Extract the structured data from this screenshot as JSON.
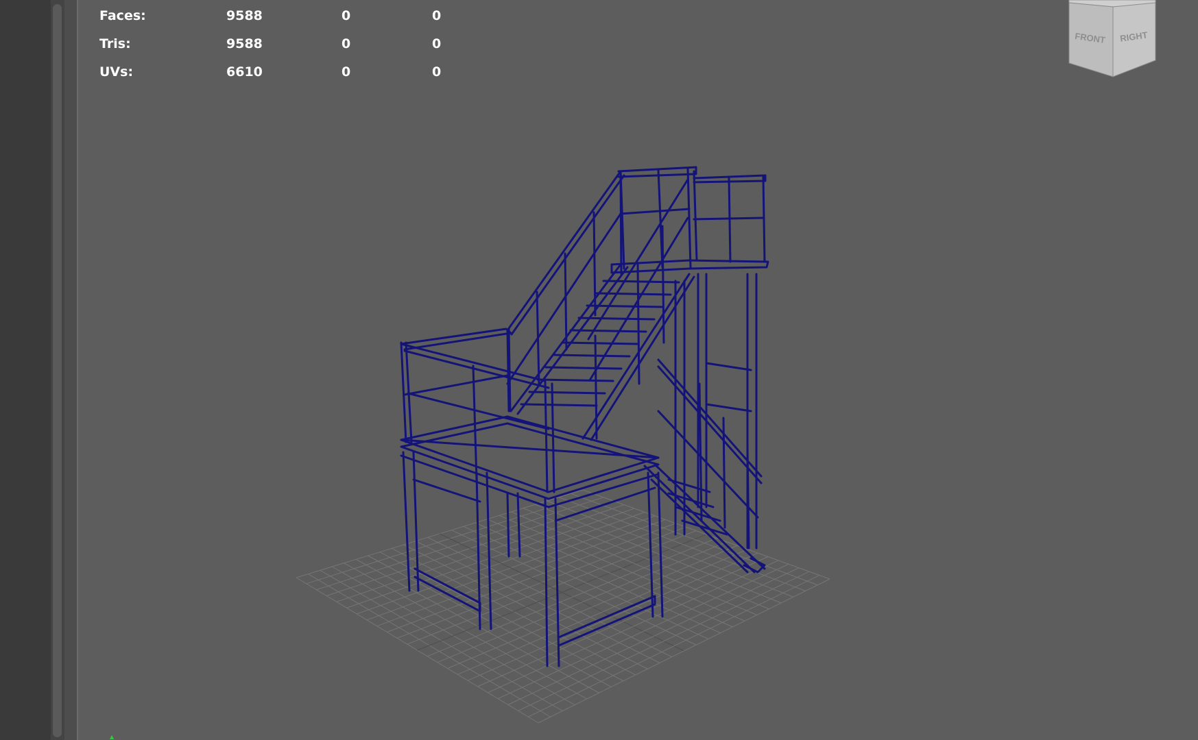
{
  "hud": {
    "rows": [
      {
        "label": "Faces:",
        "values": [
          "9588",
          "0",
          "0"
        ]
      },
      {
        "label": "Tris:",
        "values": [
          "9588",
          "0",
          "0"
        ]
      },
      {
        "label": "UVs:",
        "values": [
          "6610",
          "0",
          "0"
        ]
      }
    ]
  },
  "viewcube": {
    "front_label": "FRONT",
    "right_label": "RIGHT"
  },
  "viewport": {
    "wire_color": "#141478",
    "grid_color": "#757575",
    "background": "#5d5d5d",
    "object": "staircase-platform-wireframe"
  },
  "icons": {
    "axis": "axis-gizmo-icon"
  }
}
